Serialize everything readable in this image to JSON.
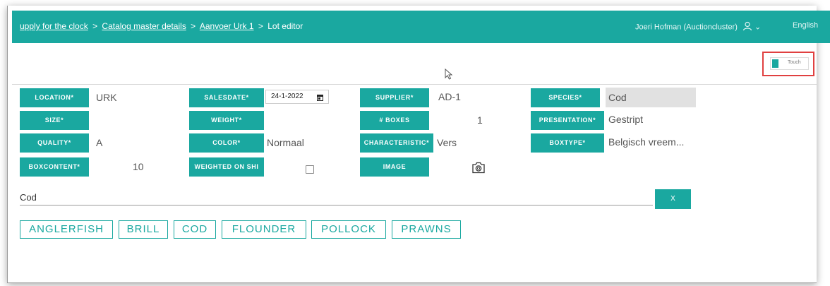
{
  "header": {
    "breadcrumb": [
      "upply for the clock",
      "Catalog master details",
      "Aanvoer Urk 1",
      "Lot editor"
    ],
    "separator": ">",
    "user": "Joeri Hofman (Auctioncluster)",
    "user_chevron": "⌄",
    "language": "English",
    "accent_color": "#1aa8a0"
  },
  "touch_toggle": {
    "label": "Touch"
  },
  "fields": {
    "location": {
      "label": "LOCATION*",
      "value": "URK"
    },
    "salesdate": {
      "label": "SALESDATE*",
      "value": "24-1-2022"
    },
    "supplier": {
      "label": "SUPPLIER*",
      "value": "AD-1"
    },
    "species": {
      "label": "SPECIES*",
      "value": "Cod"
    },
    "size": {
      "label": "SIZE*",
      "value": ""
    },
    "weight": {
      "label": "WEIGHT*",
      "value": ""
    },
    "boxes": {
      "label": "# BOXES",
      "value": "1"
    },
    "presentation": {
      "label": "PRESENTATION*",
      "value": "Gestript"
    },
    "quality": {
      "label": "QUALITY*",
      "value": "A"
    },
    "color": {
      "label": "COLOR*",
      "value": "Normaal"
    },
    "characteristic": {
      "label": "CHARACTERISTIC*",
      "value": "Vers"
    },
    "boxtype": {
      "label": "BOXTYPE*",
      "value": "Belgisch vreem..."
    },
    "boxcontent": {
      "label": "BOXCONTENT*",
      "value": "10"
    },
    "weighted_on_ship": {
      "label": "WEIGHTED ON SHI",
      "checked": false
    },
    "image": {
      "label": "IMAGE",
      "icon": "camera-icon"
    }
  },
  "search": {
    "value": "Cod",
    "clear_label": "X"
  },
  "species_options": [
    "ANGLERFISH",
    "BRILL",
    "COD",
    "FLOUNDER",
    "POLLOCK",
    "PRAWNS"
  ]
}
